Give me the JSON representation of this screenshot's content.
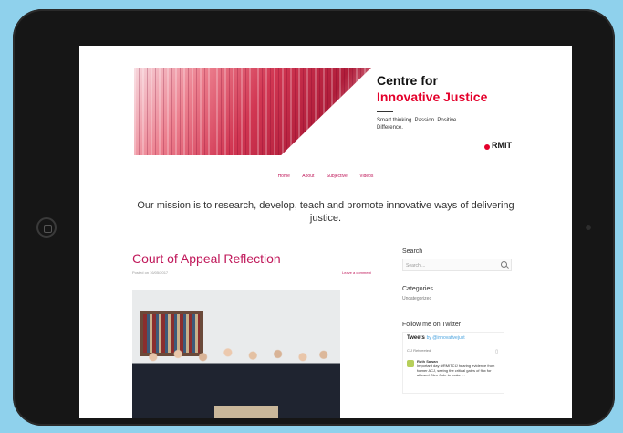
{
  "banner": {
    "title_line1": "Centre for",
    "title_line2": "Innovative Justice",
    "tagline": "Smart thinking. Passion. Positive Difference.",
    "logo_text": "RMIT"
  },
  "nav": {
    "items": [
      "Home",
      "About",
      "Subjective",
      "Videos"
    ]
  },
  "mission": "Our mission is to research, develop, teach and promote innovative ways of delivering justice.",
  "post": {
    "title": "Court of Appeal Reflection",
    "meta": "Posted on 16/05/2017",
    "comment_link": "Leave a comment"
  },
  "sidebar": {
    "search_heading": "Search",
    "search_placeholder": "Search ...",
    "categories_heading": "Categories",
    "category_item": "Uncategorized",
    "twitter_heading": "Follow me on Twitter",
    "tweets_label": "Tweets",
    "tweets_by": "by @innovativejust",
    "retweeted": "CIJ Retweeted",
    "tweet_author": "Ruth Sawan",
    "tweet_text": "Important day: #RMITCIJ hearing evidence from former ACJ, seeing the critical gates of flux for allowed Glen Cole to make …"
  },
  "colors": {
    "accent": "#c0185a",
    "brand_red": "#e4002b",
    "background": "#8fd1ec"
  }
}
